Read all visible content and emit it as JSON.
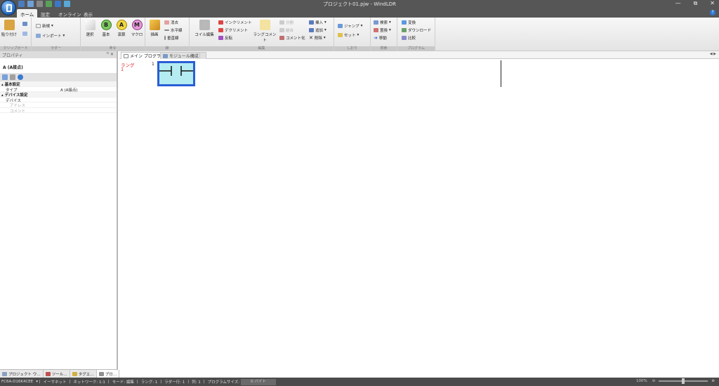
{
  "window": {
    "title": "プロジェクト01.pjw - WindLDR",
    "minimize": "—",
    "maximize": "⧉",
    "close": "✕"
  },
  "tabs": [
    "ホーム",
    "設定",
    "オンライン",
    "表示"
  ],
  "ribbon": {
    "clipboard": {
      "label": "クリップボード",
      "paste": "貼り付け"
    },
    "ladder": {
      "label": "ラダー",
      "new": "新規",
      "import": "インポート"
    },
    "symbol": {
      "label": "命令",
      "select": "選択",
      "basic": "基本",
      "calc": "演算",
      "macro": "マクロ",
      "b": "B",
      "a": "A",
      "m": "M"
    },
    "draw": {
      "label": "線",
      "draw": "描画",
      "erase": "消去",
      "horizontal": "水平線",
      "vertical": "垂直線"
    },
    "edit": {
      "label": "編集",
      "coil": "コイル編集",
      "increment": "インクリメント",
      "decrement": "デクリメント",
      "invert": "反転",
      "rung_comment": "ラングコメント",
      "split": "分割",
      "join": "結合",
      "comment": "コメント化",
      "insert": "挿入",
      "add": "追加",
      "delete": "削除"
    },
    "bookmark": {
      "label": "しおり",
      "jump": "ジャンプ",
      "set": "セット"
    },
    "search": {
      "label": "検索",
      "search": "検索",
      "replace": "置換",
      "move": "移動"
    },
    "program": {
      "label": "プログラム",
      "convert": "変換",
      "download": "ダウンロード",
      "compare": "比較"
    }
  },
  "properties": {
    "header": "プロパティ",
    "pin": "ꟸ ✕",
    "selected": "A (A接点)",
    "rows": [
      {
        "key": "基本設定",
        "val": "",
        "type": "cat"
      },
      {
        "key": "タイプ",
        "val": "A (A接点)",
        "type": "row"
      },
      {
        "key": "デバイス設定",
        "val": "",
        "type": "cat"
      },
      {
        "key": "デバイス",
        "val": "",
        "type": "row"
      },
      {
        "key": "アドレス",
        "val": "",
        "type": "sub"
      },
      {
        "key": "コメント",
        "val": "",
        "type": "sub"
      }
    ],
    "bottom_tabs": [
      "プロジェクト ウ…",
      "ツール…",
      "タグエ…",
      "プロ…"
    ]
  },
  "doc_tabs": {
    "main": "メイン プログラム",
    "module": "モジュール構成"
  },
  "editor": {
    "rung_label": "ラング",
    "rung_num": "1",
    "col_num": "1"
  },
  "status": {
    "plc": "FC6A-D16K4CEE",
    "comm": "イーサネット",
    "network": "ネットワーク: 1:1",
    "mode": "モード: 編集",
    "rung": "ラング: 1",
    "ladder_row": "ラダー行: 1",
    "col": "列: 1",
    "program_size": "プログラムサイズ:",
    "bytes": "0 バイト",
    "zoom": "100%"
  }
}
